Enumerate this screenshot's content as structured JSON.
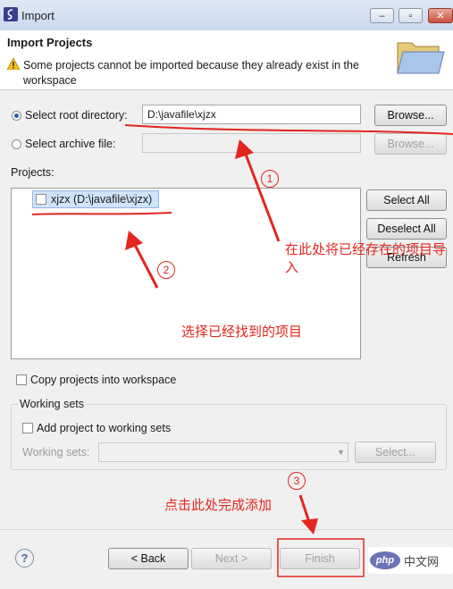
{
  "window": {
    "title": "Import",
    "minimize": "‒",
    "maximize": "▫",
    "close": "✕"
  },
  "header": {
    "title": "Import Projects",
    "warning": "Some projects cannot be imported because they already exist in the workspace"
  },
  "root_directory": {
    "label": "Select root directory:",
    "value": "D:\\javafile\\xjzx",
    "browse": "Browse..."
  },
  "archive_file": {
    "label": "Select archive file:",
    "value": "",
    "browse": "Browse..."
  },
  "projects": {
    "label": "Projects:",
    "items": [
      {
        "name": "xjzx (D:\\javafile\\xjzx)",
        "checked": false
      }
    ],
    "select_all": "Select All",
    "deselect_all": "Deselect All",
    "refresh": "Refresh"
  },
  "copy_projects": {
    "label": "Copy projects into workspace",
    "checked": false
  },
  "working_sets": {
    "group_label": "Working sets",
    "add_label": "Add project to working sets",
    "field_label": "Working sets:",
    "select": "Select..."
  },
  "footer": {
    "help": "?",
    "back": "< Back",
    "next": "Next >",
    "finish": "Finish"
  },
  "annotations": {
    "step1_num": "1",
    "step1_text": "在此处将已经存在的项目导入",
    "step2_num": "2",
    "step2_text": "选择已经找到的项目",
    "step3_num": "3",
    "step3_text": "点击此处完成添加",
    "color": "#e3261f"
  },
  "watermark": {
    "logo": "php",
    "text": "中文网"
  }
}
